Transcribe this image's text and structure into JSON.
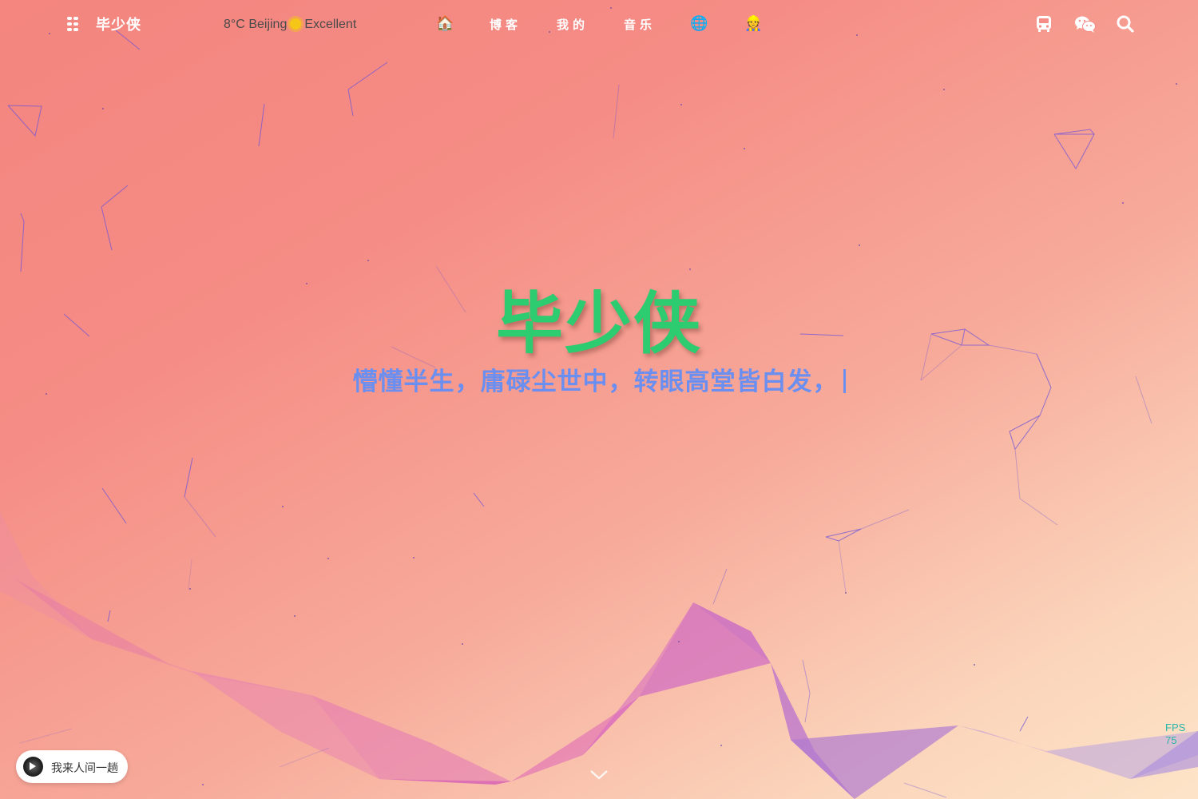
{
  "header": {
    "site_name": "毕少侠",
    "weather": {
      "temperature": "8°C",
      "city": "Beijing",
      "air_quality": "Excellent",
      "icon": "sun-icon"
    },
    "nav": [
      {
        "type": "emoji",
        "label": "🏠",
        "icon": "home-icon"
      },
      {
        "type": "text",
        "label": "博客"
      },
      {
        "type": "text",
        "label": "我的"
      },
      {
        "type": "text",
        "label": "音乐"
      },
      {
        "type": "emoji",
        "label": "🌐",
        "icon": "globe-icon"
      },
      {
        "type": "emoji",
        "label": "👷",
        "icon": "worker-icon"
      }
    ],
    "right_icons": [
      "bus-icon",
      "wechat-icon",
      "search-icon"
    ]
  },
  "hero": {
    "title": "毕少侠",
    "subtitle": "懵懂半生，庸碌尘世中，转眼高堂皆白发，"
  },
  "music_player": {
    "song_title": "我来人间一趟",
    "icon": "play-icon"
  },
  "fps": {
    "label": "FPS",
    "value": "75"
  },
  "colors": {
    "title_green": "#2ecc71",
    "subtitle_blue": "#6a8ff0",
    "wave_pink": "#e06aa8",
    "wave_purple": "#b05bd8",
    "particle_line": "#7a5bd8"
  }
}
